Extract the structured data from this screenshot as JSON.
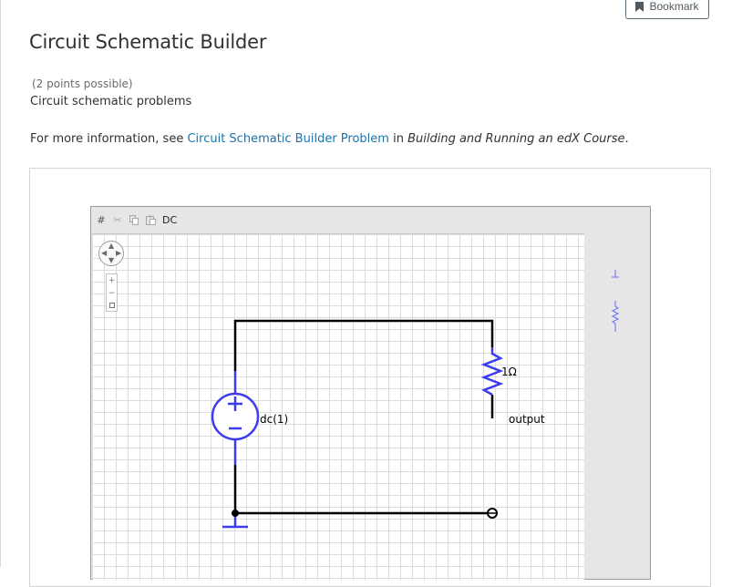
{
  "header": {
    "bookmark_label": "Bookmark"
  },
  "problem": {
    "title": "Circuit Schematic Builder",
    "points": "(2 points possible)",
    "subtitle": "Circuit schematic problems",
    "info_prefix": "For more information, see ",
    "info_link": "Circuit Schematic Builder Problem",
    "info_middle": " in ",
    "info_book": "Building and Running an edX Course",
    "info_suffix": "."
  },
  "toolbar": {
    "icons": [
      "grid-icon",
      "cut-icon",
      "copy-icon",
      "paste-icon"
    ],
    "analysis_label": "DC"
  },
  "circuit": {
    "source_label": "dc(1)",
    "resistor_label": "1Ω",
    "output_label": "output"
  },
  "colors": {
    "link": "#1d73a8",
    "component": "#3b3bf0",
    "wire": "#000000"
  }
}
